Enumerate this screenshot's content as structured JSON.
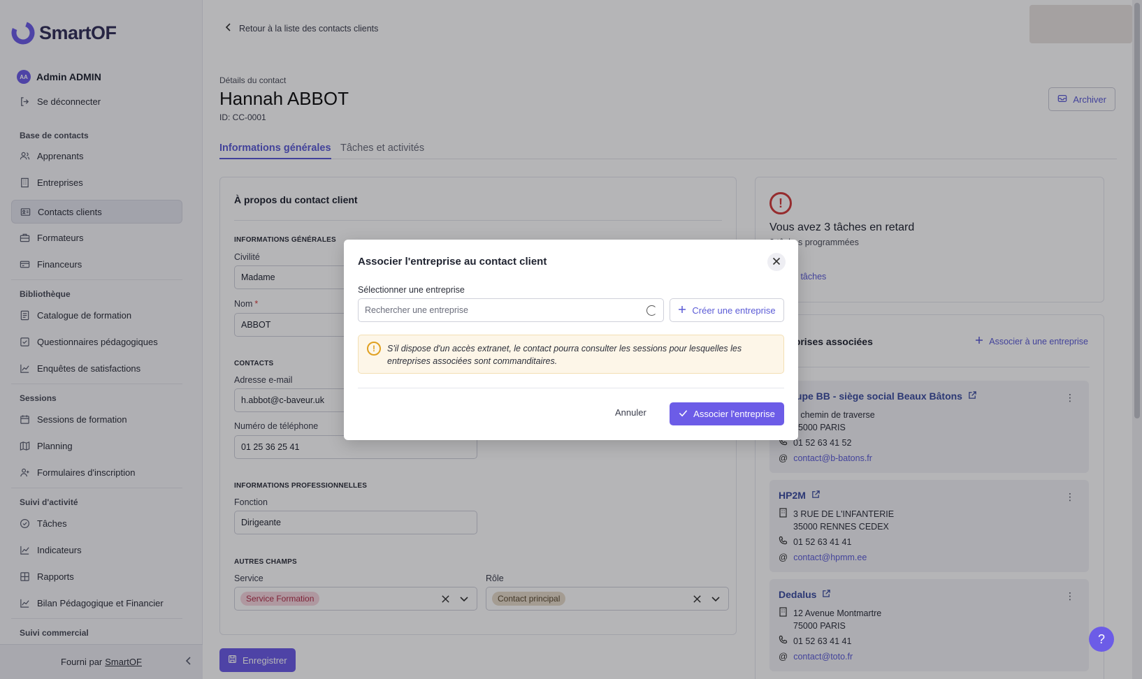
{
  "sidebar": {
    "logo_text": "SmartOF",
    "user": {
      "initials": "AA",
      "name": "Admin ADMIN"
    },
    "logout_label": "Se déconnecter",
    "sections": {
      "contacts": "Base de contacts",
      "library": "Bibliothèque",
      "sessions": "Sessions",
      "activity": "Suivi d'activité",
      "commercial": "Suivi commercial"
    },
    "items": {
      "learners": "Apprenants",
      "companies": "Entreprises",
      "client_contacts": "Contacts clients",
      "trainers": "Formateurs",
      "funders": "Financeurs",
      "catalog": "Catalogue de formation",
      "quizzes": "Questionnaires pédagogiques",
      "surveys": "Enquêtes de satisfactions",
      "training_sessions": "Sessions de formation",
      "planning": "Planning",
      "registration_forms": "Formulaires d'inscription",
      "tasks": "Tâches",
      "indicators": "Indicateurs",
      "reports": "Rapports",
      "bpf": "Bilan Pédagogique et Financier"
    },
    "footer": {
      "prefix": "Fourni par",
      "brand": "SmartOF"
    }
  },
  "header": {
    "back_label": "Retour à la liste des contacts clients",
    "details_label": "Détails du contact",
    "contact_name": "Hannah ABBOT",
    "contact_id": "ID: CC-0001",
    "archive_label": "Archiver"
  },
  "tabs": [
    "Informations générales",
    "Tâches et activités"
  ],
  "about": {
    "title": "À propos du contact client",
    "general_section": "INFORMATIONS GÉNÉRALES",
    "civility_label": "Civilité",
    "civility_value": "Madame",
    "name_label": "Nom",
    "name_value": "ABBOT",
    "contacts_section": "CONTACTS",
    "email_label": "Adresse e-mail",
    "email_value": "h.abbot@c-baveur.uk",
    "phone_label": "Numéro de téléphone",
    "phone_value": "01 25 36 25 41",
    "pro_section": "INFORMATIONS PROFESSIONNELLES",
    "function_label": "Fonction",
    "function_value": "Dirigeante",
    "other_section": "AUTRES CHAMPS",
    "service_label": "Service",
    "service_value": "Service Formation",
    "role_label": "Rôle",
    "role_value": "Contact principal",
    "save_label": "Enregistrer"
  },
  "tasks_card": {
    "late_text": "Vous avez 3 tâches en retard",
    "scheduled_text": "3 tâches programmées",
    "view_link": "Voir les tâches"
  },
  "companies_card": {
    "title": "Entreprises associées",
    "associate_label": "Associer à une entreprise",
    "items": [
      {
        "name": "Groupe BB - siège social Beaux Bâtons",
        "address1": "1 chemin de traverse",
        "address2": "75000 PARIS",
        "phone": "01 52 63 41 52",
        "email": "contact@b-batons.fr"
      },
      {
        "name": "HP2M",
        "address1": "3 RUE DE L'INFANTERIE",
        "address2": "35000 RENNES CEDEX",
        "phone": "01 52 63 41 41",
        "email": "contact@hpmm.ee"
      },
      {
        "name": "Dedalus",
        "address1": "12 Avenue Montmartre",
        "address2": "75000 PARIS",
        "phone": "01 52 63 41 41",
        "email": "contact@toto.fr"
      }
    ]
  },
  "modal": {
    "title": "Associer l'entreprise au contact client",
    "select_label": "Sélectionner une entreprise",
    "search_placeholder": "Rechercher une entreprise",
    "create_label": "Créer une entreprise",
    "warning": "S'il dispose d'un accès extranet, le contact pourra consulter les sessions pour lesquelles les entreprises associées sont commanditaires.",
    "cancel_label": "Annuler",
    "confirm_label": "Associer l'entreprise"
  },
  "colors": {
    "accent": "#6c5ce7",
    "link": "#5b5bd6",
    "danger": "#d33b3b",
    "warning": "#e0a020"
  }
}
